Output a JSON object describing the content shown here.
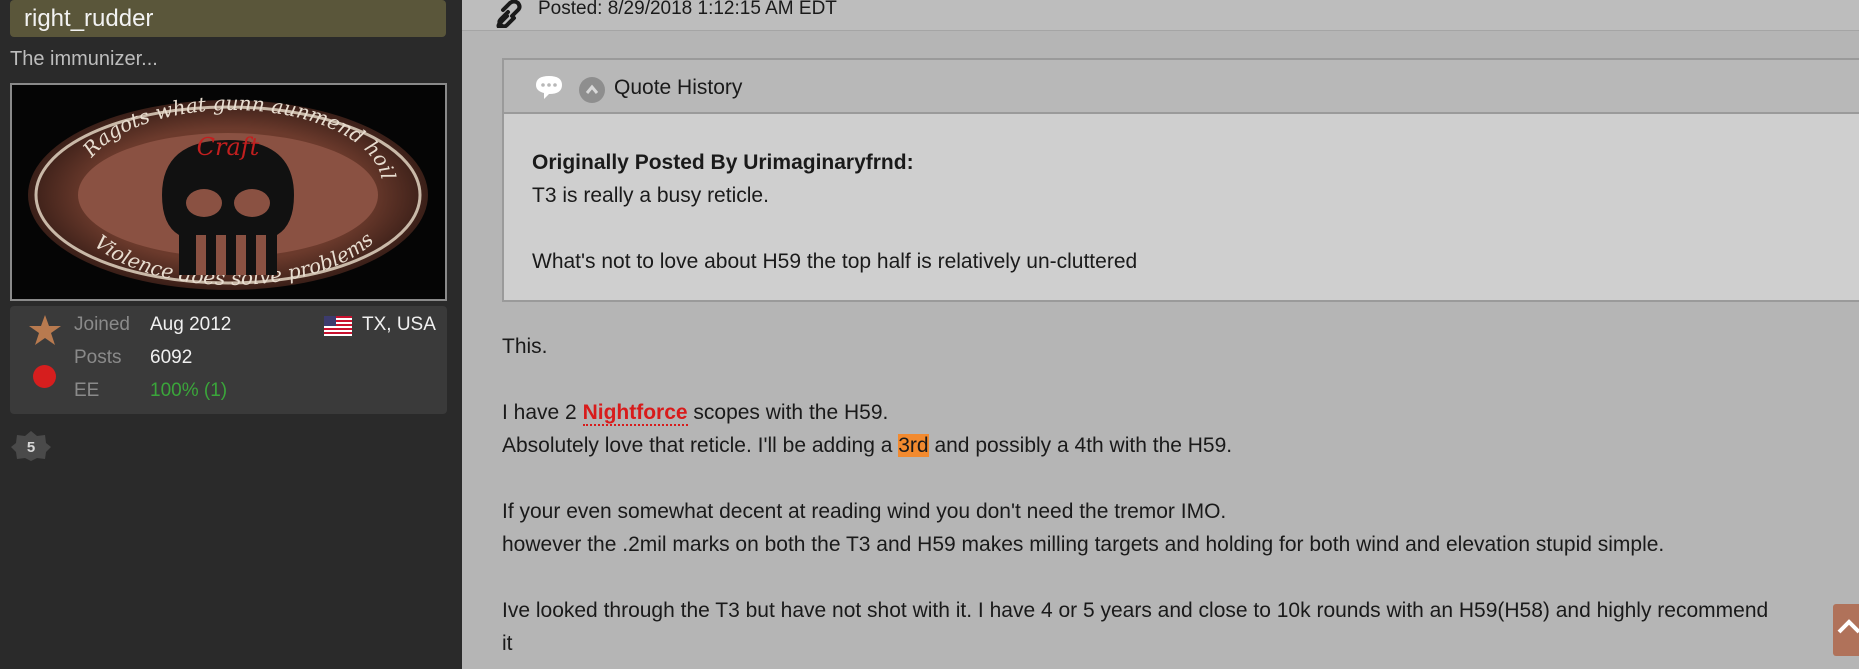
{
  "sidebar": {
    "username": "right_rudder",
    "user_title": "The immunizer...",
    "avatar_text": {
      "top_arc": "Ragots what gunn aunmend hoil pinc...",
      "center": "Craft",
      "bottom_arc": "Violence does solve problems"
    },
    "stats": {
      "joined_label": "Joined",
      "joined_value": "Aug 2012",
      "posts_label": "Posts",
      "posts_value": "6092",
      "ee_label": "EE",
      "ee_value": "100% (1)",
      "location": "TX, USA"
    },
    "badge_number": "5"
  },
  "post": {
    "posted": "Posted: 8/29/2018 1:12:15 AM EDT",
    "quote": {
      "header_label": "Quote History",
      "attribution": "Originally Posted By Urimaginaryfrnd:",
      "lines": [
        "T3 is really a busy reticle.",
        "What's not to love about H59 the top half is relatively un-cluttered"
      ]
    },
    "body": {
      "line1": "This.",
      "line2_pre": "I have 2 ",
      "line2_link": "Nightforce",
      "line2_post": " scopes with the H59.",
      "line3_pre": "Absolutely love that reticle. I'll be adding a ",
      "line3_hl": "3rd",
      "line3_post": " and possibly a 4th with the H59.",
      "line4": "If your even somewhat decent at reading wind you don't need the tremor IMO.",
      "line5": "however the .2mil marks on both the T3 and H59 makes milling targets and holding for both wind and elevation stupid simple.",
      "line6": "Ive looked through the T3 but have not shot with it. I have 4 or 5 years and close to 10k rounds with an H59(H58) and highly recommend",
      "line7": "it"
    }
  },
  "colors": {
    "sidebar_bg": "#2a2a2a",
    "username_bg": "#5a563a",
    "link_red": "#d81b1b",
    "highlight_orange": "#f28a2f",
    "ee_green": "#3aa53a"
  },
  "icons": [
    "link-icon",
    "speech-bubble-icon",
    "collapse-chevron-icon",
    "rank-star-icon",
    "status-dot-icon",
    "us-flag-icon",
    "badge-icon",
    "scroll-top-icon"
  ]
}
